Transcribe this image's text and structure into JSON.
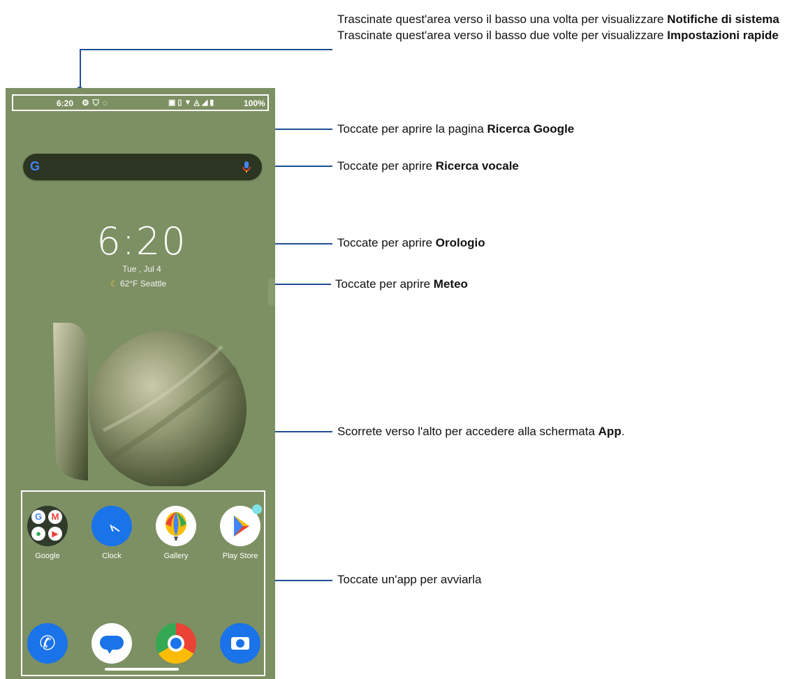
{
  "annotations": {
    "statusbar_line1": "Trascinate quest'area verso il basso una volta per visualizzare ",
    "statusbar_line1_bold": "Notifiche di sistema",
    "statusbar_line2": "Trascinate quest'area verso il basso due volte per visualizzare ",
    "statusbar_line2_bold": "Impostazioni rapide",
    "google_search": "Toccate per aprire la pagina ",
    "google_search_bold": "Ricerca Google",
    "voice_search": "Toccate per aprire ",
    "voice_search_bold": "Ricerca vocale",
    "clock": "Toccate per aprire ",
    "clock_bold": "Orologio",
    "weather": "Toccate per aprire ",
    "weather_bold": "Meteo",
    "apps_screen": "Scorrete verso l'alto per accedere alla schermata ",
    "apps_screen_bold": "App",
    "apps_screen_suffix": ".",
    "launch_app": "Toccate un'app per avviarla"
  },
  "statusbar": {
    "time": "6:20",
    "battery": "100%"
  },
  "search": {
    "logo": "G"
  },
  "clock_widget": {
    "time": "6:20",
    "date": "Tue , Jul 4",
    "weather": "62°F  Seattle"
  },
  "apps_row1": [
    {
      "label": "Google",
      "icon": "google-folder-icon"
    },
    {
      "label": "Clock",
      "icon": "clock-icon"
    },
    {
      "label": "Gallery",
      "icon": "gallery-icon"
    },
    {
      "label": "Play Store",
      "icon": "play-store-icon"
    }
  ],
  "apps_row2": [
    {
      "icon": "phone-icon"
    },
    {
      "icon": "messages-icon"
    },
    {
      "icon": "chrome-icon"
    },
    {
      "icon": "camera-icon"
    }
  ],
  "colors": {
    "annotation_line": "#1f4e96",
    "wallpaper": "#7d9063"
  }
}
